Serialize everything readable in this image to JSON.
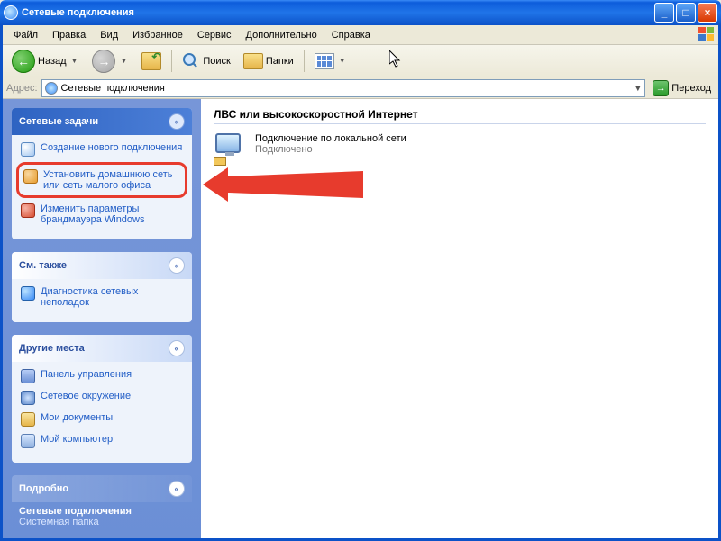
{
  "window": {
    "title": "Сетевые подключения"
  },
  "menu": {
    "file": "Файл",
    "edit": "Правка",
    "view": "Вид",
    "favorites": "Избранное",
    "tools": "Сервис",
    "extra": "Дополнительно",
    "help": "Справка"
  },
  "toolbar": {
    "back": "Назад",
    "search": "Поиск",
    "folders": "Папки"
  },
  "address": {
    "label": "Адрес:",
    "value": "Сетевые подключения",
    "go": "Переход"
  },
  "sidebar": {
    "tasks": {
      "title": "Сетевые задачи",
      "new_conn": "Создание нового подключения",
      "home_net": "Установить домашнюю сеть или сеть малого офиса",
      "firewall": "Изменить параметры брандмауэра Windows"
    },
    "see_also": {
      "title": "См. также",
      "diag": "Диагностика сетевых неполадок"
    },
    "other_places": {
      "title": "Другие места",
      "cp": "Панель управления",
      "netenv": "Сетевое окружение",
      "docs": "Мои документы",
      "mycomp": "Мой компьютер"
    },
    "details": {
      "title": "Подробно",
      "name": "Сетевые подключения",
      "type": "Системная папка"
    }
  },
  "main": {
    "group": "ЛВС или высокоскоростной Интернет",
    "item_name": "Подключение по локальной сети",
    "item_status": "Подключено"
  }
}
